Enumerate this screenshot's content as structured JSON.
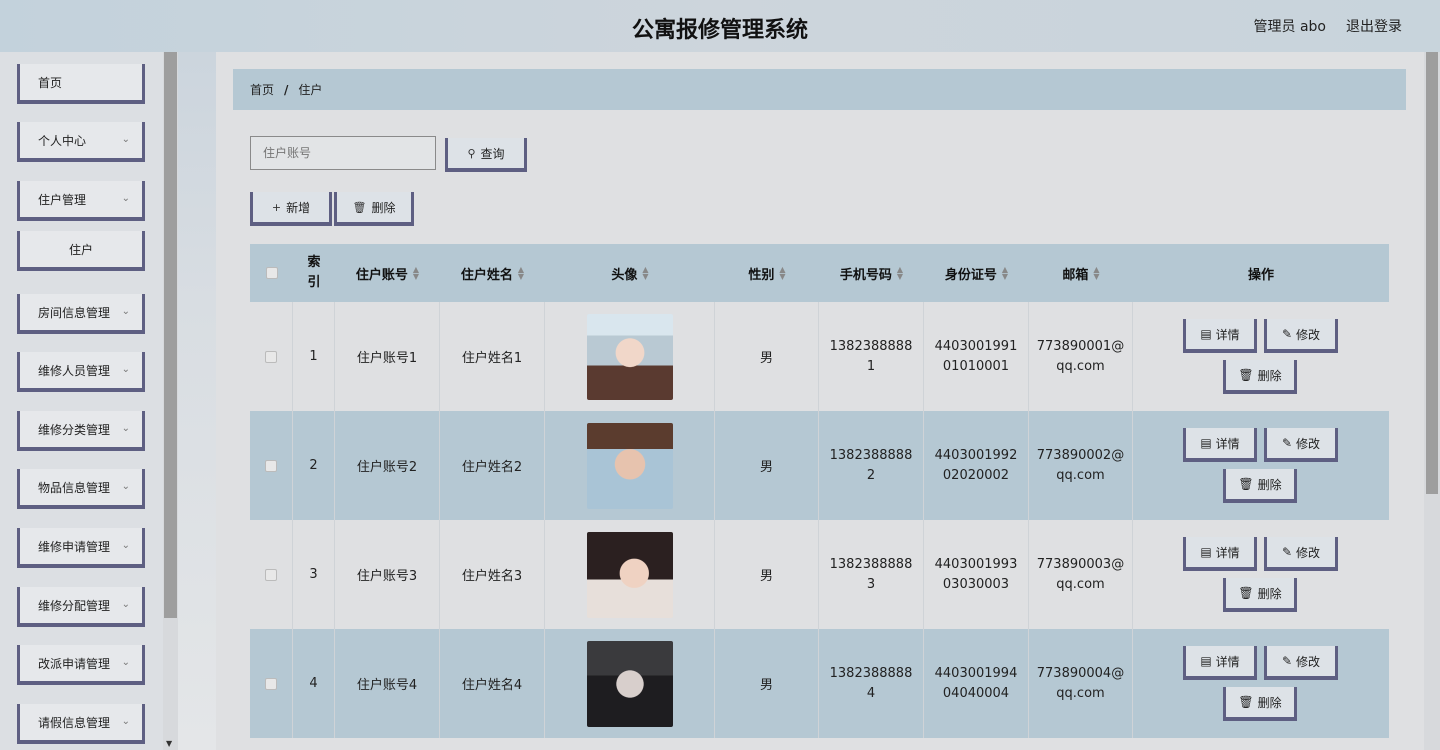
{
  "header": {
    "title": "公寓报修管理系统",
    "user_label": "管理员 abo",
    "logout_label": "退出登录"
  },
  "sidebar": {
    "items": [
      {
        "label": "首页",
        "has_children": false
      },
      {
        "label": "个人中心",
        "has_children": true
      },
      {
        "label": "住户管理",
        "has_children": true
      },
      {
        "label": "住户",
        "sub": true
      },
      {
        "label": "房间信息管理",
        "has_children": true
      },
      {
        "label": "维修人员管理",
        "has_children": true
      },
      {
        "label": "维修分类管理",
        "has_children": true
      },
      {
        "label": "物品信息管理",
        "has_children": true
      },
      {
        "label": "维修申请管理",
        "has_children": true
      },
      {
        "label": "维修分配管理",
        "has_children": true
      },
      {
        "label": "改派申请管理",
        "has_children": true
      },
      {
        "label": "请假信息管理",
        "has_children": true
      }
    ]
  },
  "breadcrumb": {
    "home": "首页",
    "separator": "/",
    "current": "住户"
  },
  "search": {
    "placeholder": "住户账号",
    "value": "",
    "button_label": "查询"
  },
  "toolbar": {
    "add_label": "新增",
    "delete_label": "删除"
  },
  "table": {
    "headers": {
      "index": "索引",
      "account": "住户账号",
      "name": "住户姓名",
      "avatar": "头像",
      "gender": "性别",
      "phone": "手机号码",
      "id_card": "身份证号",
      "email": "邮箱",
      "actions": "操作"
    },
    "action_labels": {
      "detail": "详情",
      "edit": "修改",
      "delete": "删除"
    },
    "rows": [
      {
        "index": "1",
        "account": "住户账号1",
        "name": "住户姓名1",
        "gender": "男",
        "phone": "13823888881",
        "id_card": "440300199101010001",
        "email": "773890001@qq.com"
      },
      {
        "index": "2",
        "account": "住户账号2",
        "name": "住户姓名2",
        "gender": "男",
        "phone": "13823888882",
        "id_card": "440300199202020002",
        "email": "773890002@qq.com"
      },
      {
        "index": "3",
        "account": "住户账号3",
        "name": "住户姓名3",
        "gender": "男",
        "phone": "13823888883",
        "id_card": "440300199303030003",
        "email": "773890003@qq.com"
      },
      {
        "index": "4",
        "account": "住户账号4",
        "name": "住户姓名4",
        "gender": "男",
        "phone": "13823888884",
        "id_card": "440300199404040004",
        "email": "773890004@qq.com"
      }
    ]
  },
  "colors": {
    "accent_border": "#5e5f82",
    "header_bg": "#b5c8d3"
  },
  "icons": {
    "search": "search-icon",
    "add": "plus-icon",
    "delete": "trash-icon",
    "detail": "document-icon",
    "edit": "pencil-icon",
    "submenu": "chevron-down-icon"
  }
}
